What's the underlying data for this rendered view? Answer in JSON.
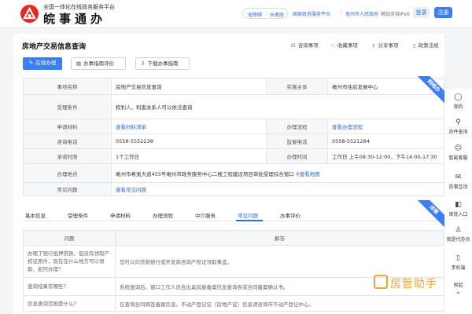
{
  "header": {
    "subtitle": "全国一体化在线政务服务平台",
    "logo_text": "皖事通办",
    "pill_a": "无障碍",
    "pill_sep": "|",
    "pill_b": "长者版",
    "link1": "国家政务服务平台",
    "link_sep": "|",
    "link2": "亳州市人民政府",
    "ipv6": "网站支持IPv6",
    "login": "登录",
    "register": "注册"
  },
  "page": {
    "title": "房地产交易信息查询",
    "actions": [
      {
        "icon": "headset-icon",
        "label": "咨询事项"
      },
      {
        "icon": "star-icon",
        "label": "收藏事项"
      },
      {
        "icon": "share-icon",
        "label": "分享事项"
      },
      {
        "icon": "bookmark-icon",
        "label": "政策法规"
      }
    ],
    "buttons": {
      "online": "在线办理",
      "guide_review": "办事指南评价",
      "download_guide": "下载办事指南"
    },
    "ribbon": "网络办"
  },
  "info": {
    "item_name_label": "事项名称",
    "item_name": "房地产交易信息查询",
    "subject_label": "实施主体",
    "subject": "亳州市住房发展中心",
    "conditions_label": "受理条件",
    "conditions": "权利人、利害关系人可以依法查询",
    "materials_label": "申请材料",
    "materials": "查看材料清单",
    "process_label": "办理流程",
    "process": "查看办理流程",
    "hotline_label": "咨询电话",
    "hotline": "0558-5552238",
    "supervise_label": "监督电话",
    "supervise": "0558-5521284",
    "promise_label": "承诺时限",
    "promise": "1个工作日",
    "hours_label": "办理时间",
    "hours": "工作日 上午08:30-12:00，下午14:00-17:30",
    "location_label": "办理地点",
    "location": "亳州市希夷大道455号亳州市政务服务中心二楼工程建设项目审批受理综合窗口",
    "map_link": "查看地图",
    "faq_label": "常见问题",
    "faq": "查看常见问题"
  },
  "tabs": [
    "基本信息",
    "受理条件",
    "申请材料",
    "办理流程",
    "中介服务",
    "常见问题",
    "办事评价"
  ],
  "active_tab": "常见问题",
  "ribbon2": "详情",
  "qa": {
    "headers": [
      "问题",
      "解答"
    ],
    "rows": [
      {
        "q": "办理了银行抵押贷款、但没有领取产权证原件，现在在什么地方可以领取、如何办理？",
        "a": "您可以向贷款银行或开发商咨询产权证领取事宜。"
      },
      {
        "q": "查询结果有哪些？",
        "a": "系统查询后，窗口工作人员会出具房屋备案信息查询表或合同备案确认书。"
      },
      {
        "q": "信息查询范围是什么？",
        "a": "仅查询合同网签备案信息。不动产登记证（房地产证）信息请咨询市不动产登记中心。"
      }
    ]
  },
  "sidebar": [
    {
      "icon": "user-icon",
      "label": "我的"
    },
    {
      "icon": "search-icon",
      "label": "办件查询"
    },
    {
      "icon": "robot-icon",
      "label": "智能客服"
    },
    {
      "icon": "chat-icon",
      "label": "办事互动"
    },
    {
      "icon": "door-icon",
      "label": "审批入口"
    },
    {
      "icon": "agent-icon",
      "label": "我是代办员"
    },
    {
      "icon": "phone-icon",
      "label": "手机端"
    },
    {
      "icon": "collapse-icon",
      "label": "收起"
    }
  ],
  "watermark": "房管助手"
}
